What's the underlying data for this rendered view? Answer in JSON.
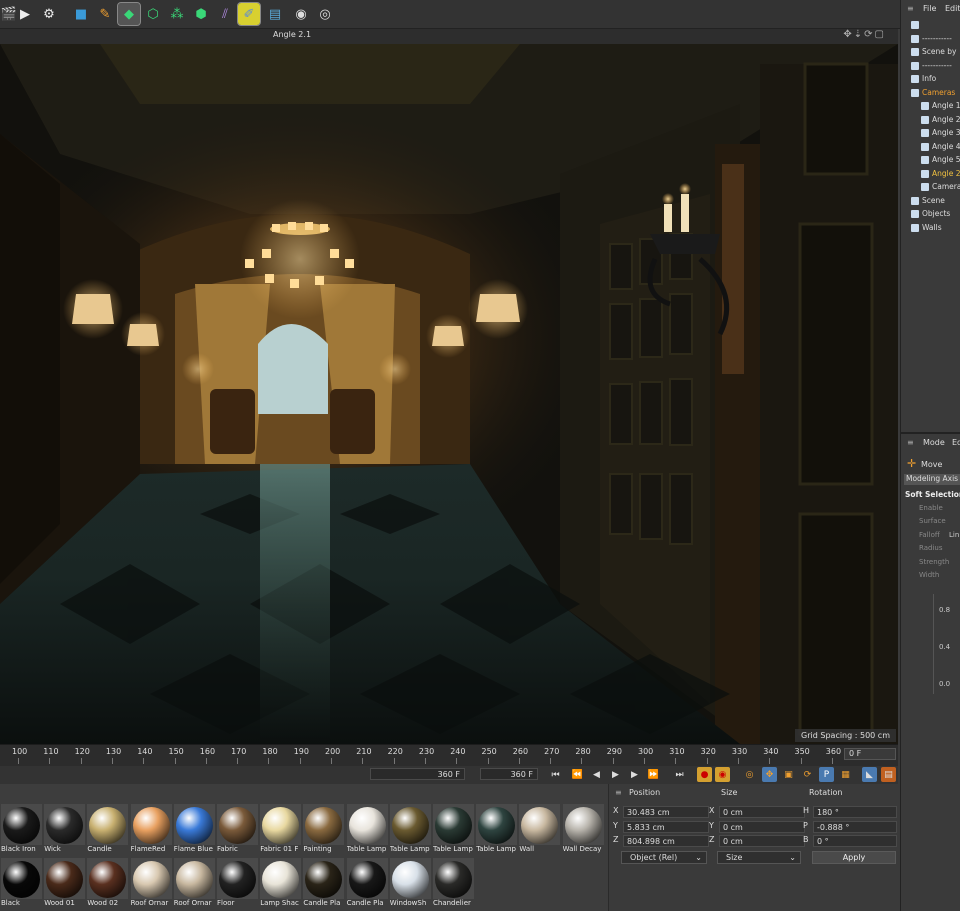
{
  "toolbar": {
    "icons": [
      "clapper-icon",
      "render-icon",
      "render-settings-icon",
      "cube-icon",
      "pen-icon",
      "subdivision-icon",
      "array-icon",
      "mograph-icon",
      "cloner-icon",
      "deformer-icon",
      "sketch-icon",
      "floor-icon",
      "camera-icon",
      "light-icon"
    ]
  },
  "viewport": {
    "camera_name": "Angle 2.1",
    "grid_spacing": "Grid Spacing : 500 cm"
  },
  "timeline": {
    "ticks": [
      "100",
      "110",
      "120",
      "130",
      "140",
      "150",
      "160",
      "170",
      "180",
      "190",
      "200",
      "210",
      "220",
      "230",
      "240",
      "250",
      "260",
      "270",
      "280",
      "290",
      "300",
      "310",
      "320",
      "330",
      "340",
      "350",
      "360"
    ],
    "current_frame": "0 F"
  },
  "transport": {
    "end_frame": "360 F",
    "max_frame": "360 F"
  },
  "materials": [
    {
      "name": "Black Iron",
      "color": "#1a1a1a"
    },
    {
      "name": "Wick",
      "color": "#2a2a2a"
    },
    {
      "name": "Candle",
      "color": "#c8b070"
    },
    {
      "name": "FlameRed",
      "color": "#e8a060"
    },
    {
      "name": "Flame Blue",
      "color": "#3a7ad8"
    },
    {
      "name": "Fabric",
      "color": "#7a5a3a"
    },
    {
      "name": "Fabric 01 F",
      "color": "#e8d8a0"
    },
    {
      "name": "Painting",
      "color": "#8a6a40"
    },
    {
      "name": "Table Lamp",
      "color": "#e8e4dc"
    },
    {
      "name": "Table Lamp",
      "color": "#6a5a30"
    },
    {
      "name": "Table Lamp",
      "color": "#2a3a34"
    },
    {
      "name": "Table Lamp",
      "color": "#2e4440"
    },
    {
      "name": "Wall",
      "color": "#c8b8a0"
    },
    {
      "name": "Wall Decay",
      "color": "#b8b4ac"
    },
    {
      "name": "Black",
      "color": "#080808"
    },
    {
      "name": "Wood 01",
      "color": "#4a2a1a"
    },
    {
      "name": "Wood 02",
      "color": "#5a3020"
    },
    {
      "name": "Roof Ornar",
      "color": "#d8c8b0"
    },
    {
      "name": "Roof Ornar",
      "color": "#c8b8a0"
    },
    {
      "name": "Floor",
      "color": "#222222"
    },
    {
      "name": "Lamp Shac",
      "color": "#e8e4d8"
    },
    {
      "name": "Candle Pla",
      "color": "#2a2418"
    },
    {
      "name": "Candle Pla",
      "color": "#181818"
    },
    {
      "name": "WindowSh",
      "color": "#d8e0e8"
    },
    {
      "name": "Chandelier",
      "color": "#2a2a28"
    }
  ],
  "coords": {
    "position_label": "Position",
    "size_label": "Size",
    "rotation_label": "Rotation",
    "rows": [
      {
        "axis": "X",
        "pos": "30.483 cm",
        "saxis": "X",
        "size": "0 cm",
        "raxis": "H",
        "rot": "180 °"
      },
      {
        "axis": "Y",
        "pos": "5.833 cm",
        "saxis": "Y",
        "size": "0 cm",
        "raxis": "P",
        "rot": "-0.888 °"
      },
      {
        "axis": "Z",
        "pos": "804.898 cm",
        "saxis": "Z",
        "size": "0 cm",
        "raxis": "B",
        "rot": "0 °"
      }
    ],
    "mode_dropdown": "Object (Rel)",
    "size_dropdown": "Size",
    "apply": "Apply"
  },
  "objmgr": {
    "menu_file": "File",
    "menu_edit": "Edit",
    "items": [
      {
        "label": "",
        "indent": 10,
        "color": "#ddd"
      },
      {
        "label": "-----------",
        "indent": 10,
        "color": "#ddd"
      },
      {
        "label": "Scene by",
        "indent": 10,
        "color": "#ddd"
      },
      {
        "label": "-----------",
        "indent": 10,
        "color": "#ddd"
      },
      {
        "label": "Info",
        "indent": 10,
        "color": "#ddd"
      },
      {
        "label": "Cameras",
        "indent": 10,
        "color": "#f0a030"
      },
      {
        "label": "Angle 1",
        "indent": 20,
        "color": "#ddd"
      },
      {
        "label": "Angle 2",
        "indent": 20,
        "color": "#ddd"
      },
      {
        "label": "Angle 3",
        "indent": 20,
        "color": "#ddd"
      },
      {
        "label": "Angle 4",
        "indent": 20,
        "color": "#ddd"
      },
      {
        "label": "Angle 5",
        "indent": 20,
        "color": "#ddd"
      },
      {
        "label": "Angle 2",
        "indent": 20,
        "color": "#f0c040"
      },
      {
        "label": "Camera",
        "indent": 20,
        "color": "#ddd"
      },
      {
        "label": "Scene",
        "indent": 10,
        "color": "#ddd"
      },
      {
        "label": "Objects",
        "indent": 10,
        "color": "#ddd"
      },
      {
        "label": "Walls",
        "indent": 10,
        "color": "#ddd"
      }
    ]
  },
  "attr": {
    "menu_mode": "Mode",
    "menu_edit": "Edi",
    "tool": "Move",
    "tab": "Modeling Axis",
    "section": "Soft Selection",
    "props": [
      "Enable",
      "Surface",
      "Falloff",
      "Radius",
      "Strength",
      "Width"
    ],
    "falloff_value": "Lin",
    "graph_ticks": [
      "0.8",
      "0.4",
      "0.0"
    ]
  }
}
